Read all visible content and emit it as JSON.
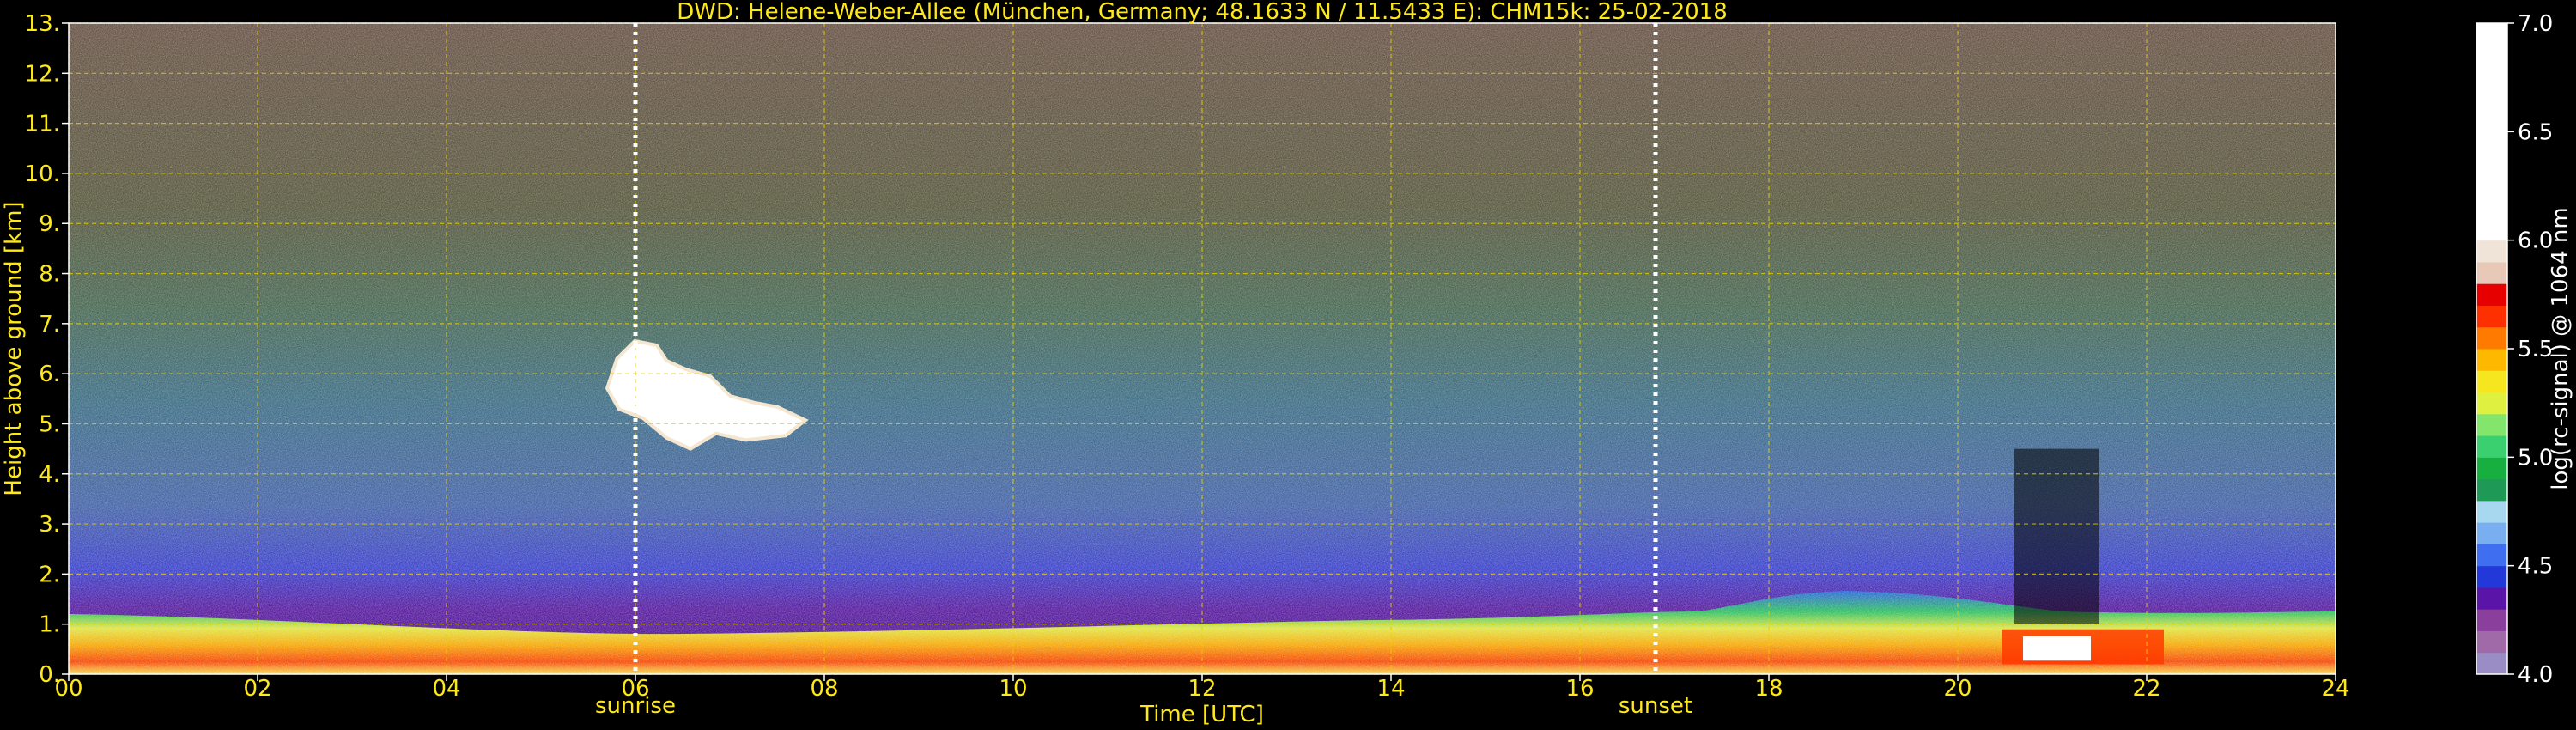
{
  "chart_data": {
    "type": "heatmap",
    "title": "DWD: Helene-Weber-Allee (München, Germany; 48.1633 N / 11.5433 E):    CHM15k: 25-02-2018",
    "xlabel": "Time [UTC]",
    "ylabel": "Height above ground [km]",
    "x_ticks": [
      "00",
      "02",
      "04",
      "06",
      "08",
      "10",
      "12",
      "14",
      "16",
      "18",
      "20",
      "22",
      "24"
    ],
    "y_ticks": [
      "0.",
      "1.",
      "2.",
      "3.",
      "4.",
      "5.",
      "6.",
      "7.",
      "8.",
      "9.",
      "10.",
      "11.",
      "12.",
      "13."
    ],
    "xlim": [
      0,
      24
    ],
    "ylim": [
      0,
      13
    ],
    "grid": true,
    "markers": [
      {
        "label": "sunrise",
        "time_utc": 6.0
      },
      {
        "label": "sunset",
        "time_utc": 16.8
      }
    ],
    "colorbar": {
      "label": "log(rc-signal) @ 1064 nm",
      "range": [
        4.0,
        7.0
      ],
      "ticks": [
        "4.0",
        "4.5",
        "5.0",
        "5.5",
        "6.0",
        "6.5",
        "7.0"
      ],
      "colors": [
        "#9a8cc4",
        "#a06aa8",
        "#8a3f9c",
        "#5a14a8",
        "#2238d8",
        "#3f6ff0",
        "#79aef0",
        "#a8d8f0",
        "#1e9a56",
        "#17b040",
        "#3ad070",
        "#82e66c",
        "#dff040",
        "#f5e620",
        "#ffb800",
        "#ff7a00",
        "#ff3000",
        "#e60000",
        "#e8c9b8",
        "#f0e4d8",
        "#ffffff"
      ]
    },
    "features": {
      "cloud": {
        "time_utc": [
          5.7,
          7.8
        ],
        "height_km": [
          4.5,
          6.7
        ]
      },
      "boundary_layer_top_km": 1.1,
      "high_signal_layer": {
        "time_utc": [
          20.6,
          21.5
        ],
        "height_km": [
          0.3,
          1.0
        ]
      }
    }
  }
}
